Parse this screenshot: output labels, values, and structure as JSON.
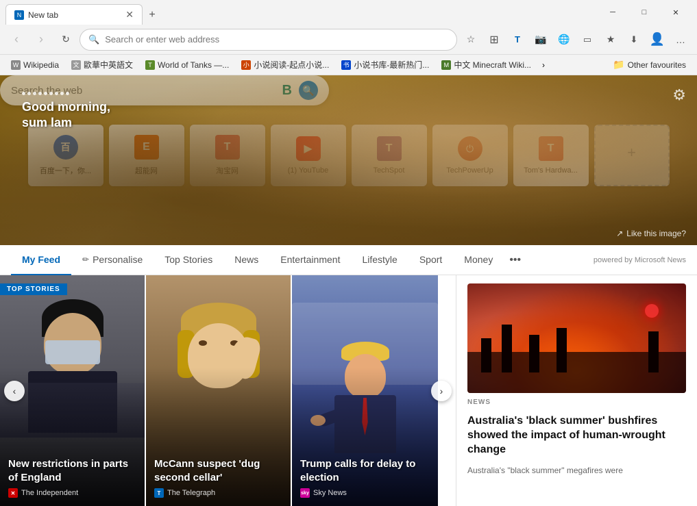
{
  "window": {
    "title": "New tab",
    "minimize": "─",
    "maximize": "□",
    "close": "✕"
  },
  "tab": {
    "label": "New tab",
    "close_icon": "✕",
    "new_tab_icon": "+"
  },
  "nav": {
    "back_icon": "‹",
    "forward_icon": "›",
    "refresh_icon": "↻",
    "address_placeholder": "Search or enter web address",
    "star_icon": "☆",
    "collections_icon": "▣",
    "split_icon": "⊟",
    "translate_icon": "T",
    "camera_icon": "◉",
    "globe_icon": "◎",
    "reading_icon": "▭",
    "favorites_icon": "★",
    "downloads_icon": "⊕",
    "profile_icon": "○",
    "more_icon": "…"
  },
  "bookmarks": [
    {
      "label": "Wikipedia",
      "icon": "W"
    },
    {
      "label": "歐華中英語文",
      "icon": "文"
    },
    {
      "label": "World of Tanks —...",
      "icon": "T"
    },
    {
      "label": "小说阅读-起点小说...",
      "icon": "小"
    },
    {
      "label": "小说书库-最新热门...",
      "icon": "书"
    },
    {
      "label": "中文 Minecraft Wiki...",
      "icon": "M"
    }
  ],
  "bookmarks_more": "›",
  "bookmarks_other_label": "Other favourites",
  "hero": {
    "dots_icon": "⋯",
    "greeting": "Good morning,",
    "username": "sum lam",
    "search_placeholder": "Search the web",
    "bing_icon": "Ⓑ",
    "lens_icon": "🔍",
    "gear_icon": "⚙",
    "like_image_icon": "↗",
    "like_image_label": "Like this image?"
  },
  "quick_links": [
    {
      "label": "百度一下，你...",
      "icon": "百",
      "color": "#2969d6"
    },
    {
      "label": "超能网",
      "icon": "E",
      "color": "#e85d04"
    },
    {
      "label": "淘宝网",
      "icon": "T",
      "color": "#e24d4d"
    },
    {
      "label": "(1) YouTube",
      "icon": "▶",
      "color": "#ff0000"
    },
    {
      "label": "TechSpot",
      "icon": "T",
      "color": "#7b2d8b"
    },
    {
      "label": "TechPowerUp",
      "icon": "⏻",
      "color": "#cc2200"
    },
    {
      "label": "Tom's Hardwa...",
      "icon": "T",
      "color": "#e0442c"
    },
    {
      "label": "",
      "icon": "+",
      "color": "#888",
      "is_add": true
    }
  ],
  "feed": {
    "tabs": [
      {
        "label": "My Feed",
        "active": true
      },
      {
        "label": "Personalise",
        "has_icon": true
      },
      {
        "label": "Top Stories"
      },
      {
        "label": "News"
      },
      {
        "label": "Entertainment"
      },
      {
        "label": "Lifestyle"
      },
      {
        "label": "Sport"
      },
      {
        "label": "Money"
      }
    ],
    "more_icon": "•••",
    "powered_by": "powered by Microsoft News"
  },
  "news_cards": [
    {
      "badge": "TOP STORIES",
      "title": "New restrictions in parts of England",
      "source": "The Independent",
      "source_color": "#cc0000"
    },
    {
      "title": "McCann suspect 'dug second cellar'",
      "source": "The Telegraph",
      "source_color": "#0067b8"
    },
    {
      "title": "Trump calls for delay to election",
      "source": "Sky News",
      "source_color": "#cc0099"
    }
  ],
  "side_news": {
    "badge": "NEWS",
    "title": "Australia's 'black summer' bushfires showed the impact of human-wrought change",
    "description": "Australia's \"black summer\" megafires were"
  },
  "carousel": {
    "left_arrow": "‹",
    "right_arrow": "›"
  }
}
